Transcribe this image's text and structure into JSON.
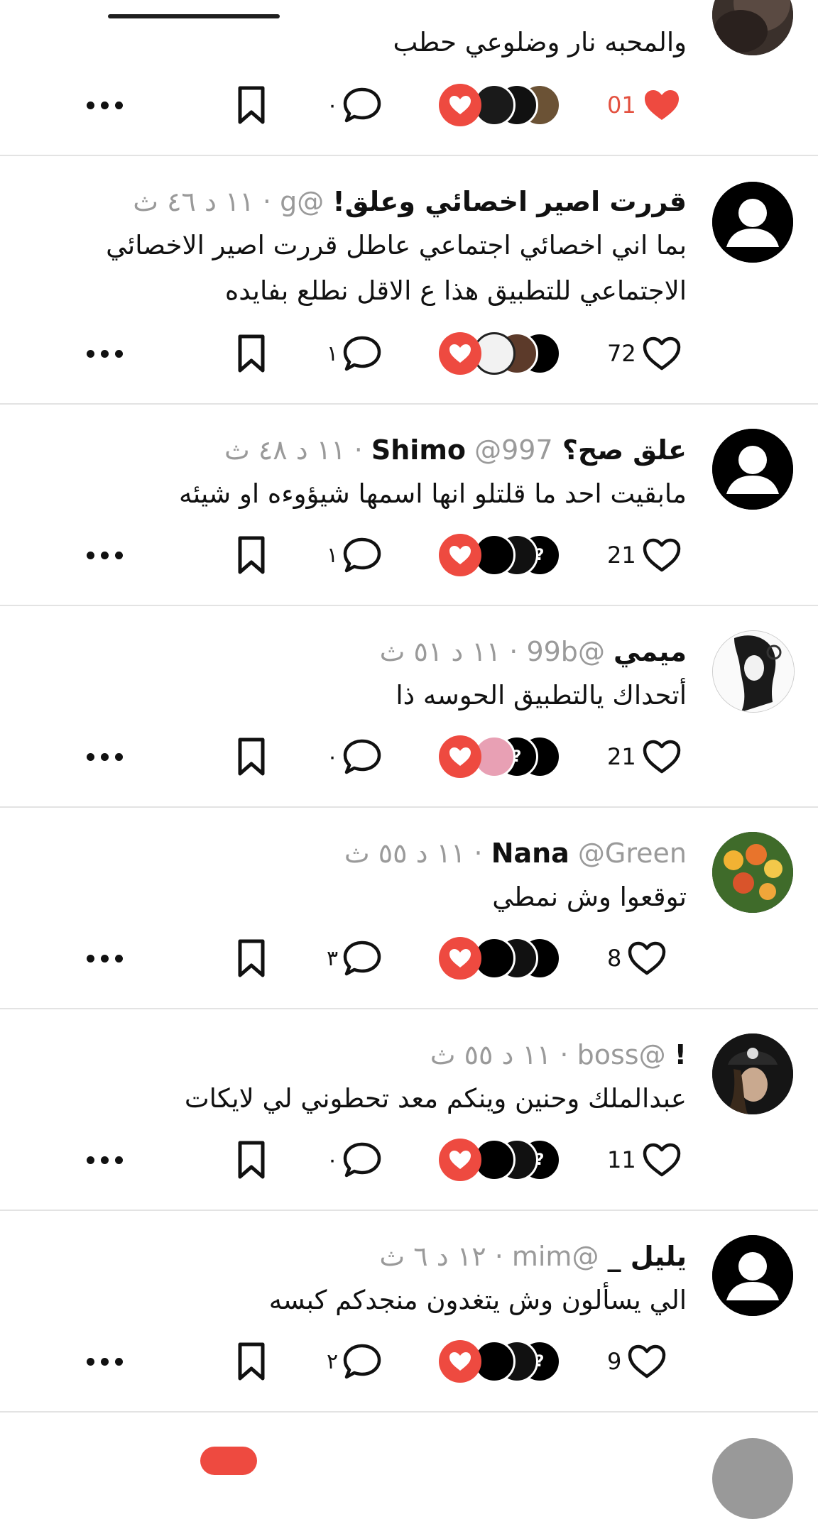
{
  "colors": {
    "accent_red": "#ee4a40",
    "meta_gray": "#9a9a9a",
    "divider": "#e3e3e3"
  },
  "posts": [
    {
      "name": "",
      "meta": "",
      "text": "والمحبه نار وضلوعي حطب",
      "likes": "01",
      "liked": true,
      "comments": "٠",
      "avatar": "photo-dark"
    },
    {
      "name": "قررت اصير اخصائي وعلق!",
      "meta": "@g · ١١ د ٤٦ ث",
      "text": "بما اني اخصائي اجتماعي عاطل قررت اصير الاخصائي الاجتماعي للتطبيق هذا ع الاقل نطلع بفايده",
      "likes": "72",
      "liked": false,
      "comments": "١",
      "avatar": "default-user"
    },
    {
      "name": "علق صح؟ Shimo",
      "meta": "@997 · ١١ د ٤٨ ث",
      "text": "مابقيت احد ما قلتلو انها اسمها شيؤوءه او شيئه",
      "likes": "21",
      "liked": false,
      "comments": "١",
      "avatar": "default-user"
    },
    {
      "name": "ميمي",
      "meta": "@99b · ١١ د ٥١ ث",
      "text": "أتحداك يالتطبيق الحوسه ذا",
      "likes": "21",
      "liked": false,
      "comments": "٠",
      "avatar": "sketch-girl"
    },
    {
      "name": "Nana",
      "meta": "@Green · ١١ د ٥٥ ث",
      "text": "توقعوا وش نمطي",
      "likes": "8",
      "liked": false,
      "comments": "٣",
      "avatar": "flowers"
    },
    {
      "name": "!",
      "meta": "@boss · ١١ د ٥٥ ث",
      "text": "عبدالملك وحنين وينكم معد تحطوني لي لايكات",
      "likes": "11",
      "liked": false,
      "comments": "٠",
      "avatar": "hat-person"
    },
    {
      "name": "يليل _",
      "meta": "@mim · ١٢ د ٦ ث",
      "text": "الي يسألون وش يتغدون منجدكم كبسه",
      "likes": "9",
      "liked": false,
      "comments": "٢",
      "avatar": "default-user"
    }
  ],
  "icons": {
    "more": "more-dots-icon",
    "bookmark": "bookmark-icon",
    "comment": "comment-bubble-icon",
    "heart": "heart-icon",
    "question": "?"
  }
}
